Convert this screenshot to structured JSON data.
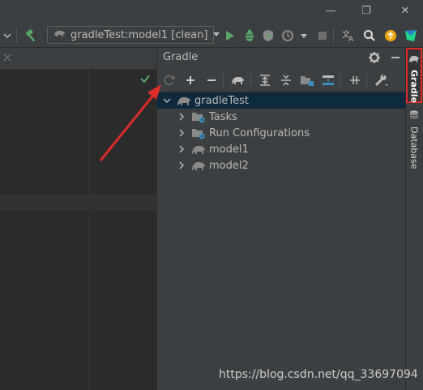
{
  "window": {
    "restore_glyph": "❐",
    "close_glyph": "✕",
    "minimize_glyph": "—"
  },
  "toolbar": {
    "run_config_label": "gradleTest:model1 [clean]"
  },
  "gradle": {
    "title": "Gradle",
    "tree": {
      "root": "gradleTest",
      "children": [
        {
          "label": "Tasks",
          "icon": "folder-gear-icon"
        },
        {
          "label": "Run Configurations",
          "icon": "folder-gear-icon"
        },
        {
          "label": "model1",
          "icon": "gradle-elephant-icon"
        },
        {
          "label": "model2",
          "icon": "gradle-elephant-icon"
        }
      ]
    }
  },
  "right_stripe": {
    "gradle_label": "Gradle",
    "database_label": "Database"
  },
  "watermark": "https://blog.csdn.net/qq_33697094",
  "colors": {
    "accent_green": "#59a869",
    "selection": "#0d293e",
    "annotation_red": "#e02b2b",
    "blue_icon": "#3592c4"
  }
}
